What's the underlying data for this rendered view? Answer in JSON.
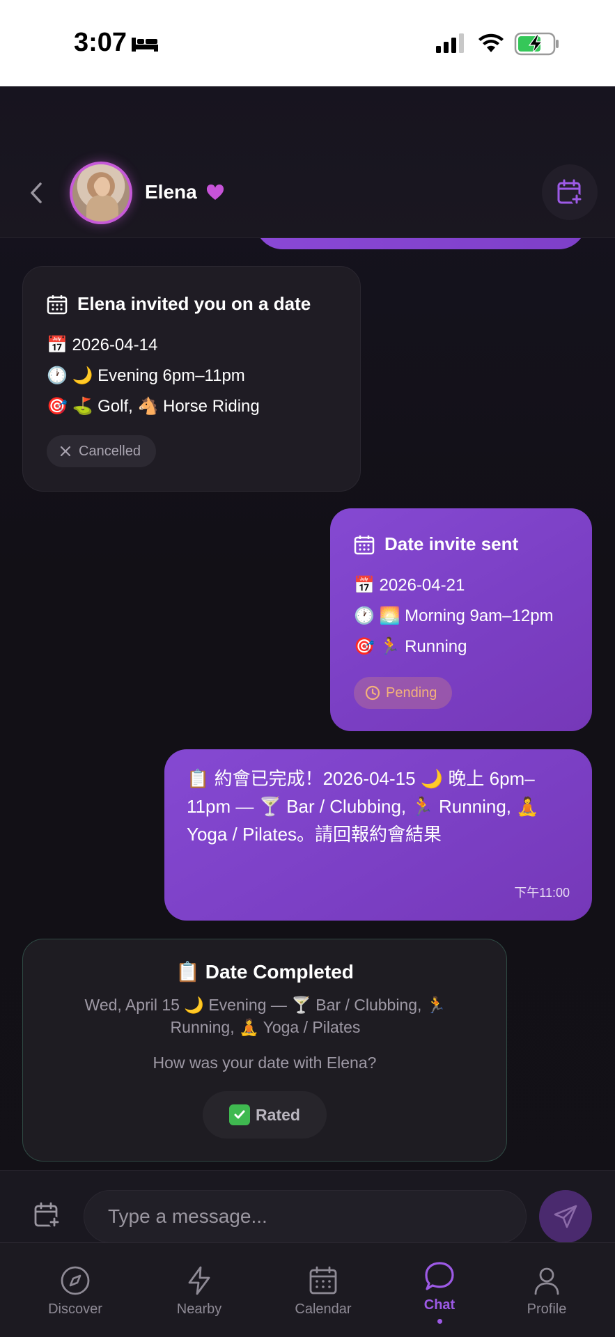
{
  "status_bar": {
    "time": "3:07"
  },
  "header": {
    "contact_name": "Elena"
  },
  "received_invite": {
    "title": "Elena invited you on a date",
    "date_line": "📅 2026-04-14",
    "time_line": "🕐 🌙 Evening 6pm–11pm",
    "activity_line": "🎯 ⛳ Golf, 🐴 Horse Riding",
    "status": "Cancelled"
  },
  "sent_invite": {
    "title": "Date invite sent",
    "date_line": "📅 2026-04-21",
    "time_line": "🕐 🌅 Morning 9am–12pm",
    "activity_line": "🎯 🏃 Running",
    "status": "Pending"
  },
  "message": {
    "text": "📋 約會已完成！2026-04-15 🌙 晚上 6pm–11pm — 🍸 Bar / Clubbing, 🏃 Running, 🧘 Yoga / Pilates。請回報約會結果",
    "time": "下午11:00"
  },
  "completed_card": {
    "title": "📋 Date Completed",
    "detail": "Wed, April 15 🌙 Evening — 🍸 Bar / Clubbing, 🏃 Running, 🧘 Yoga / Pilates",
    "question": "How was your date with Elena?",
    "rated_label": "Rated"
  },
  "composer": {
    "placeholder": "Type a message..."
  },
  "tabs": [
    {
      "label": "Discover",
      "icon": "compass-icon"
    },
    {
      "label": "Nearby",
      "icon": "lightning-icon"
    },
    {
      "label": "Calendar",
      "icon": "calendar-icon"
    },
    {
      "label": "Chat",
      "icon": "chat-bubble-icon",
      "active": true
    },
    {
      "label": "Profile",
      "icon": "person-icon"
    }
  ],
  "colors": {
    "accent": "#9d5ae6",
    "bubble": "#7e3fc8",
    "background": "#141218",
    "pending": "#f3b27a"
  }
}
